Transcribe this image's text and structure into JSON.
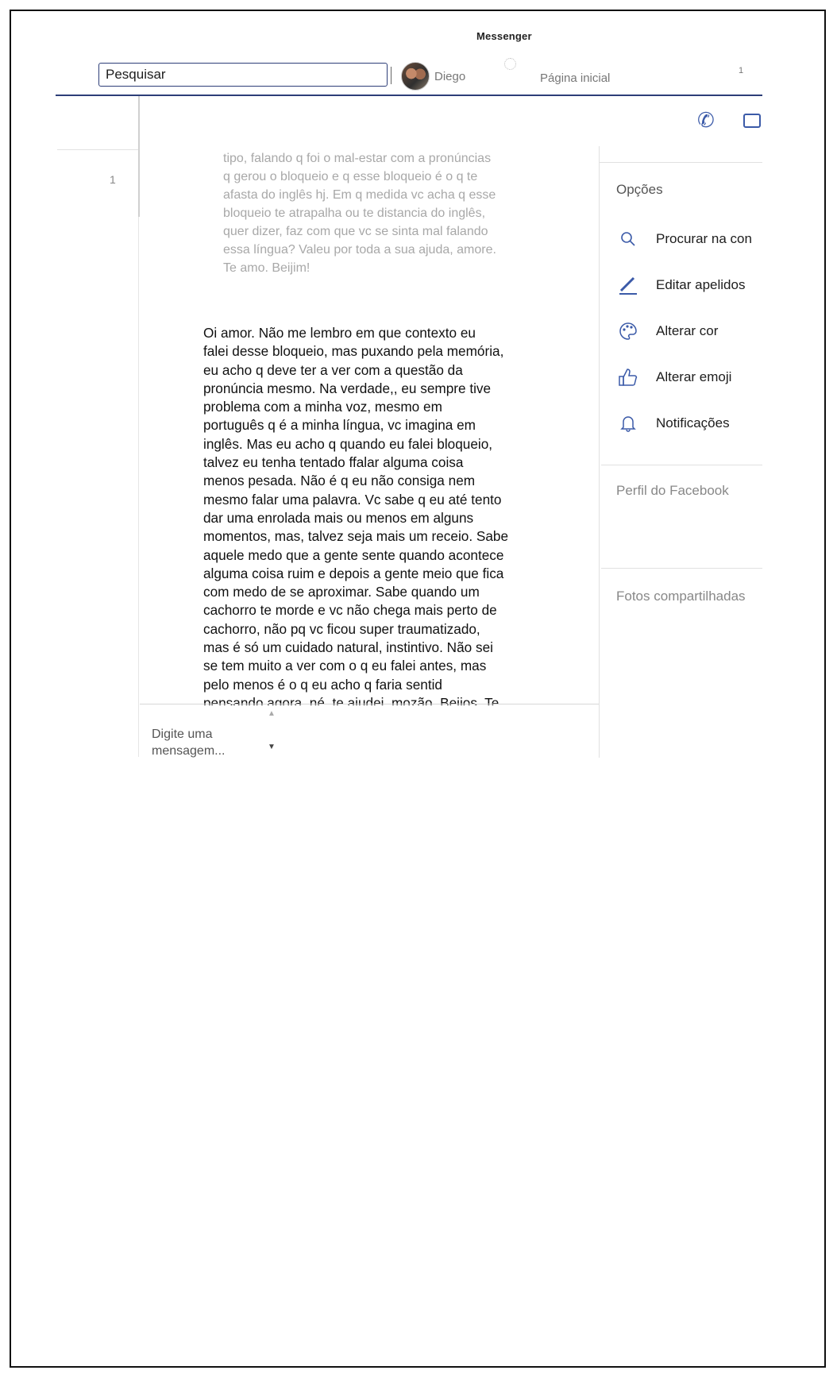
{
  "app": {
    "title": "Messenger"
  },
  "header": {
    "search_placeholder": "Pesquisar",
    "profile_name": "Diego",
    "home_label": "Página inicial",
    "notification_count": "1"
  },
  "sidebar": {
    "conversation_count": "1"
  },
  "conversation": {
    "faded_message": "tipo, falando q foi o mal-estar com a pronúncias\nq gerou o bloqueio e q esse bloqueio é o q te\nafasta do inglês hj. Em q medida vc acha q esse\nbloqueio te atrapalha ou te distancia do inglês,\nquer dizer, faz com que vc se sinta mal falando\nessa língua? Valeu por toda a sua ajuda, amore.\nTe amo. Beijim!",
    "main_message": "Oi amor. Não me lembro em que contexto eu\nfalei desse bloqueio, mas puxando pela memória,\neu acho q deve ter a ver com a questão da\npronúncia mesmo. Na verdade,, eu sempre tive\nproblema com a minha voz, mesmo em\nportuguês q é a minha língua, vc imagina em\ninglês. Mas eu acho q quando eu falei bloqueio,\ntalvez eu tenha tentado ffalar alguma coisa\nmenos pesada. Não é q eu não consiga nem\nmesmo falar uma palavra. Vc sabe q eu até tento\ndar uma enrolada mais ou menos em alguns\nmomentos, mas, talvez seja mais um receio. Sabe\naquele medo que a gente sente quando acontece\nalguma coisa ruim e depois a gente meio que fica\ncom medo de se aproximar. Sabe quando um\ncachorro te morde e vc não chega mais perto de\ncachorro, não pq vc ficou super traumatizado,\nmas é só um cuidado natural, instintivo. Não sei\nse tem muito a ver com o q eu falei antes, mas\npelo menos é o q eu acho q faria sentid\npensando agora, né, te ajudei, mozão. Beijos. Te",
    "composer_placeholder": "Digite uma mensagem..."
  },
  "right_panel": {
    "options_heading": "Opções",
    "items": [
      {
        "label": "Procurar na con",
        "icon": "search-icon"
      },
      {
        "label": "Editar apelidos",
        "icon": "pencil-icon"
      },
      {
        "label": "Alterar cor",
        "icon": "palette-icon"
      },
      {
        "label": "Alterar emoji",
        "icon": "thumbs-up-icon"
      },
      {
        "label": "Notificações",
        "icon": "bell-icon"
      }
    ],
    "facebook_profile": "Perfil do Facebook",
    "shared_photos": "Fotos compartilhadas"
  },
  "colors": {
    "accent": "#3b5aa8",
    "header_rule": "#2d3e78"
  }
}
